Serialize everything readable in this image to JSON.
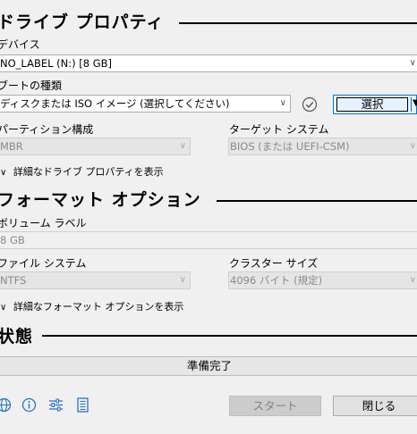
{
  "drive_properties": {
    "title": "ドライブ プロパティ",
    "device_label": "デバイス",
    "device_value": "NO_LABEL (N:) [8 GB]",
    "boot_label": "ブートの種類",
    "boot_value": "ディスクまたは ISO イメージ (選択してください)",
    "select_button": "選択",
    "partition_label": "パーティション構成",
    "partition_value": "MBR",
    "target_label": "ターゲット システム",
    "target_value": "BIOS (または UEFI-CSM)",
    "advanced_toggle": "詳細なドライブ プロパティを表示"
  },
  "format_options": {
    "title": "フォーマット オプション",
    "volume_label": "ボリューム ラベル",
    "volume_value": "8 GB",
    "filesystem_label": "ファイル システム",
    "filesystem_value": "NTFS",
    "cluster_label": "クラスター サイズ",
    "cluster_value": "4096 バイト (規定)",
    "advanced_toggle": "詳細なフォーマット オプションを表示"
  },
  "status": {
    "title": "状態",
    "text": "準備完了"
  },
  "buttons": {
    "start": "スタート",
    "close": "閉じる"
  },
  "icons": [
    "globe-icon",
    "info-icon",
    "settings-sliders-icon",
    "log-icon",
    "check-circle-icon",
    "chevron-down-icon"
  ],
  "colors": {
    "icon_blue": "#2a73c8",
    "progress_bg": "#e6e6e6",
    "select_focus": "#0078d7"
  }
}
